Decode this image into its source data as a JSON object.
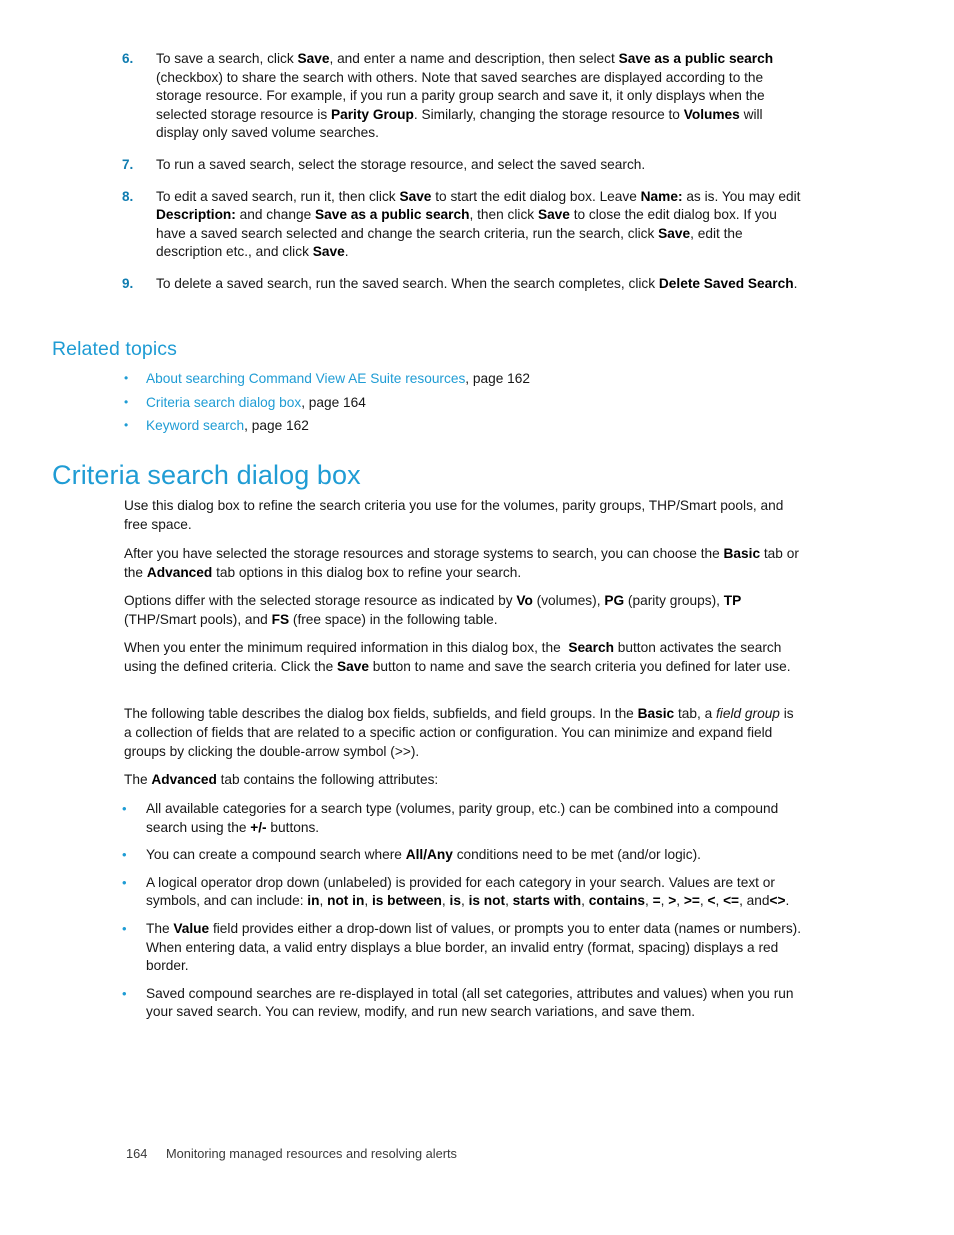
{
  "procedure": {
    "items": [
      {
        "number": "6.",
        "html": "To save a search, click <b>Save</b>, and enter a name and description, then select <b>Save as a public search</b> (checkbox) to share the search with others. Note that saved searches are displayed according to the storage resource. For example, if you run a parity group search and save it, it only displays when the selected storage resource is <b>Parity Group</b>. Similarly, changing the storage resource to <b>Volumes</b> will display only saved volume searches."
      },
      {
        "number": "7.",
        "html": "To run a saved search, select the storage resource, and select the saved search."
      },
      {
        "number": "8.",
        "html": "To edit a saved search, run it, then click <b>Save</b> to start the edit dialog box. Leave <b>Name:</b> as is. You may edit <b>Description:</b> and change <b>Save as a public search</b>, then click <b>Save</b> to close the edit dialog box. If you have a saved search selected and change the search criteria, run the search, click <b>Save</b>, edit the description etc., and click <b>Save</b>."
      },
      {
        "number": "9.",
        "html": "To delete a saved search, run the saved search. When the search completes, click <b>Delete Saved Search</b>."
      }
    ]
  },
  "related_topics": {
    "heading": "Related topics",
    "bullet_glyph": "•",
    "links": [
      {
        "link_text": "About searching Command View AE Suite resources",
        "page_ref": ", page 162"
      },
      {
        "link_text": "Criteria search dialog box",
        "page_ref": ", page 164"
      },
      {
        "link_text": "Keyword search",
        "page_ref": ", page 162"
      }
    ]
  },
  "chapter": {
    "heading": "Criteria search dialog box",
    "paragraphs": [
      {
        "html": "Use this dialog box to refine the search criteria you use for the volumes, parity groups, THP/Smart pools, and free space."
      },
      {
        "html": "After you have selected the storage resources and storage systems to search, you can choose the <b>Basic</b> tab or the <b>Advanced</b> tab options in this dialog box to refine your search."
      },
      {
        "html": "Options differ with the selected storage resource as indicated by <b>Vo</b> (volumes), <b>PG</b> (parity groups), <b>TP</b> (THP/Smart pools), and <b>FS</b> (free space) in the following table."
      },
      {
        "html": "When you enter the minimum required information in this dialog box, the&nbsp; <b>Search</b> button activates the search using the defined criteria. Click the <b>Save</b> button to name and save the search criteria you defined for later use."
      },
      {
        "html": "The following table describes the dialog box fields, subfields, and field groups. In the <b>Basic</b> tab, a <i>field group</i> is a collection of fields that are related to a specific action or configuration. You can minimize and expand field groups by clicking the double-arrow symbol (&gt;&gt;)."
      },
      {
        "html": "The <b>Advanced</b> tab contains the following attributes:"
      }
    ]
  },
  "attributes": {
    "bullet_glyph": "•",
    "items": [
      {
        "html": "All available categories for a search type (volumes, parity group, etc.) can be combined into a compound search using the <b>+/-</b> buttons."
      },
      {
        "html": "You can create a compound search where <b>All/Any</b> conditions need to be met (and/or logic)."
      },
      {
        "html": "A logical operator drop down (unlabeled) is provided for each category in your search. Values are text or symbols, and can include: <b>in</b>, <b>not in</b>, <b>is between</b>, <b>is</b>, <b>is not</b>, <b>starts with</b>, <b>contains</b>, <b>=</b>, <b>&gt;</b>, <b>&gt;=</b>, <b>&lt;</b>, <b>&lt;=</b>, and<b>&lt;&gt;</b>."
      },
      {
        "html": "The <b>Value</b> field provides either a drop-down list of values, or prompts you to enter data (names or numbers). When entering data, a valid entry displays a blue border, an invalid entry (format, spacing) displays a red border."
      },
      {
        "html": "Saved compound searches are re-displayed in total (all set categories, attributes and values) when you run your saved search. You can review, modify, and run new search variations, and save them."
      }
    ]
  },
  "footer": {
    "page_number": "164",
    "title": "Monitoring managed resources and resolving alerts"
  },
  "colors": {
    "heading_blue": "#1f9cd4",
    "list_number_blue": "#0f7cb0",
    "link_blue": "#1f9cd4",
    "body_text": "#161616",
    "page_background": "#ffffff"
  }
}
